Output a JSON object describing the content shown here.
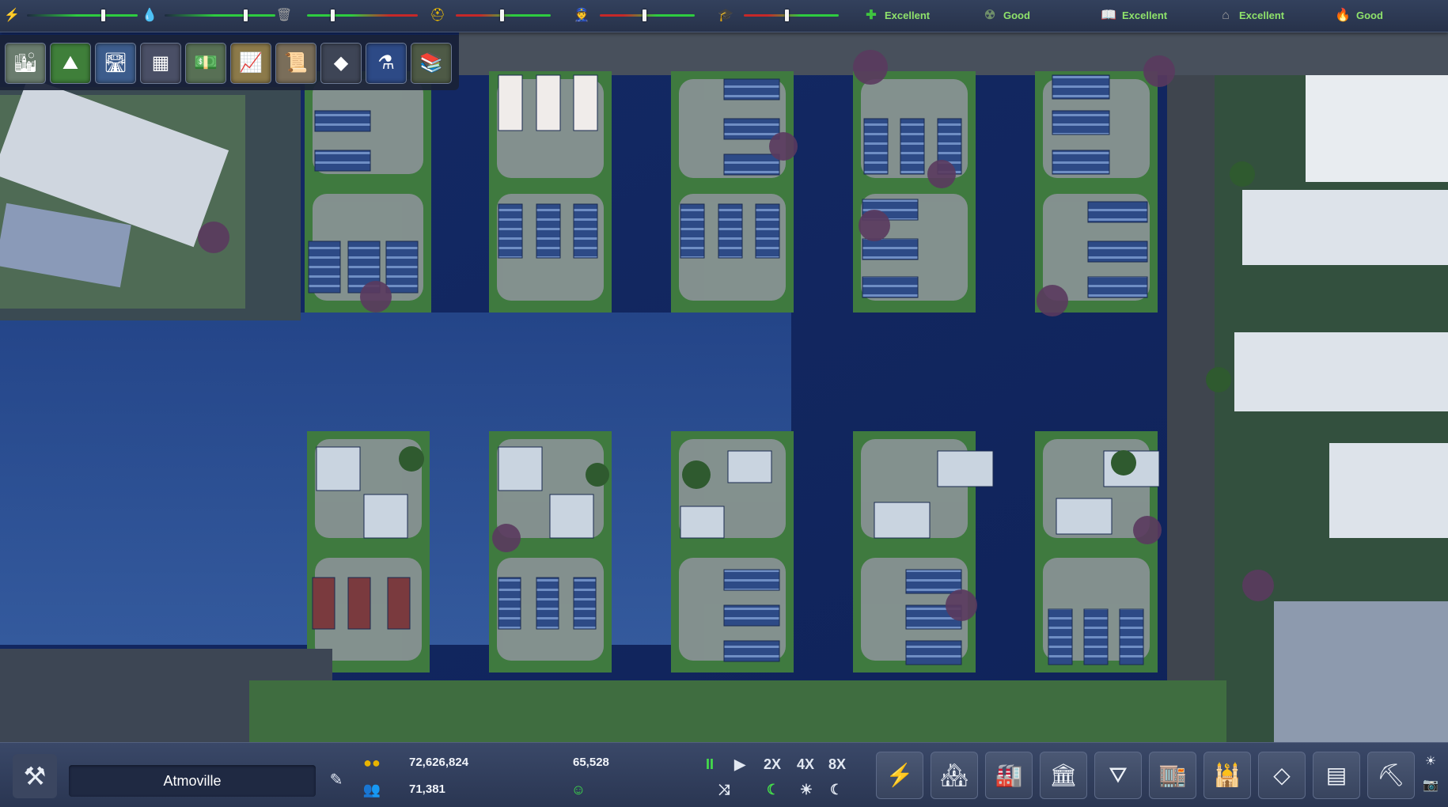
{
  "status_bar": {
    "meters": [
      {
        "name": "electricity",
        "icon": "⚡",
        "color": "#f5c400",
        "value": 0.6,
        "style": "g"
      },
      {
        "name": "water",
        "icon": "💧",
        "color": "#29a8ff",
        "value": 0.6,
        "style": "g"
      },
      {
        "name": "waste",
        "icon": "🗑",
        "color": "#a0a0a0",
        "value": 0.2,
        "style": "r"
      },
      {
        "name": "workers",
        "icon": "⛑",
        "color": "#f6c200",
        "value": 0.5,
        "style": "r"
      },
      {
        "name": "police",
        "icon": "👮",
        "color": "#ffffff",
        "value": 0.45,
        "style": "r"
      },
      {
        "name": "education",
        "icon": "🎓",
        "color": "#ffffff",
        "value": 0.4,
        "style": "r"
      }
    ],
    "ratings": [
      {
        "name": "health",
        "icon": "✚",
        "icon_color": "#3fc53f",
        "label": "Excellent"
      },
      {
        "name": "environment",
        "icon": "☢",
        "icon_color": "#6f8f6a",
        "label": "Good"
      },
      {
        "name": "culture",
        "icon": "📖",
        "icon_color": "#d8d8d8",
        "label": "Excellent"
      },
      {
        "name": "security",
        "icon": "⌂",
        "icon_color": "#a0a0a0",
        "label": "Excellent"
      },
      {
        "name": "fire",
        "icon": "🔥",
        "icon_color": "#ff5a3a",
        "label": "Good"
      }
    ]
  },
  "categories": [
    {
      "name": "city-overview",
      "icon": "🏙"
    },
    {
      "name": "terrain",
      "icon": "⛰"
    },
    {
      "name": "transport",
      "icon": "🛣"
    },
    {
      "name": "districts",
      "icon": "▦"
    },
    {
      "name": "economy",
      "icon": "💵"
    },
    {
      "name": "statistics",
      "icon": "📈"
    },
    {
      "name": "policies",
      "icon": "📜"
    },
    {
      "name": "resources",
      "icon": "◆"
    },
    {
      "name": "research",
      "icon": "⚗"
    },
    {
      "name": "library",
      "icon": "📚"
    }
  ],
  "bottom_bar": {
    "city_name": "Atmoville",
    "money": "72,626,824",
    "population": "71,381",
    "jobs": "65,528",
    "happiness_icon": "☺",
    "speed_controls": {
      "pause": "II",
      "play": "▶",
      "x2": "2X",
      "x4": "4X",
      "x8": "8X"
    },
    "time_controls": {
      "random": "⤨",
      "daynight": "☾",
      "day": "☀",
      "night": "☾"
    },
    "build_tools": [
      {
        "name": "power",
        "icon": "⚡"
      },
      {
        "name": "residential",
        "icon": "🏘"
      },
      {
        "name": "industry",
        "icon": "🏭"
      },
      {
        "name": "services",
        "icon": "🏛"
      },
      {
        "name": "roads",
        "icon": "⛛"
      },
      {
        "name": "commercial",
        "icon": "🏬"
      },
      {
        "name": "landmarks",
        "icon": "🕌"
      },
      {
        "name": "structures",
        "icon": "◇"
      },
      {
        "name": "decoration",
        "icon": "▤"
      },
      {
        "name": "demolish",
        "icon": "⛏"
      }
    ],
    "weather_icon": "☀",
    "camera_icon": "📷"
  }
}
